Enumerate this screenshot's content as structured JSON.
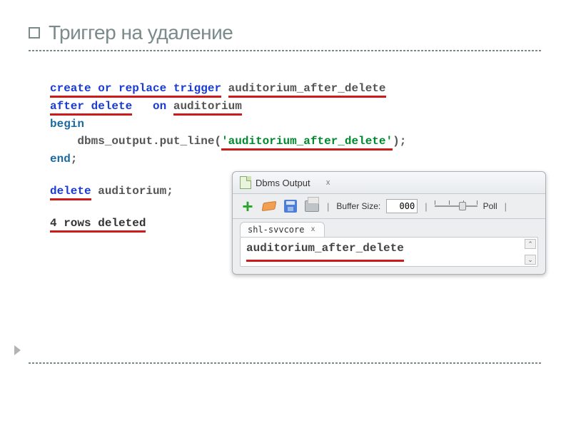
{
  "slide": {
    "title": "Триггер на удаление"
  },
  "code": {
    "line1_kw": "create or replace trigger",
    "line1_ident": "auditorium_after_delete",
    "line2_kw1": "after delete",
    "line2_kw2": "on",
    "line2_ident": "auditorium",
    "line3": "begin",
    "line4_call": "dbms_output.put_line",
    "line4_open": "(",
    "line4_str": "'auditorium_after_delete'",
    "line4_close": ");",
    "line5": "end",
    "line5_semi": ";",
    "line6_kw": "delete",
    "line6_ident": "auditorium;",
    "line7": "4 rows deleted"
  },
  "panel": {
    "title": "Dbms Output",
    "close": "x",
    "buffer_label": "Buffer Size:",
    "buffer_value": "000",
    "poll_label": "Poll",
    "sep": "|",
    "tab": "shl-svvcore",
    "tab_close": "x",
    "output": "auditorium_after_delete",
    "scroll_up": "⌃",
    "scroll_down": "⌄"
  }
}
